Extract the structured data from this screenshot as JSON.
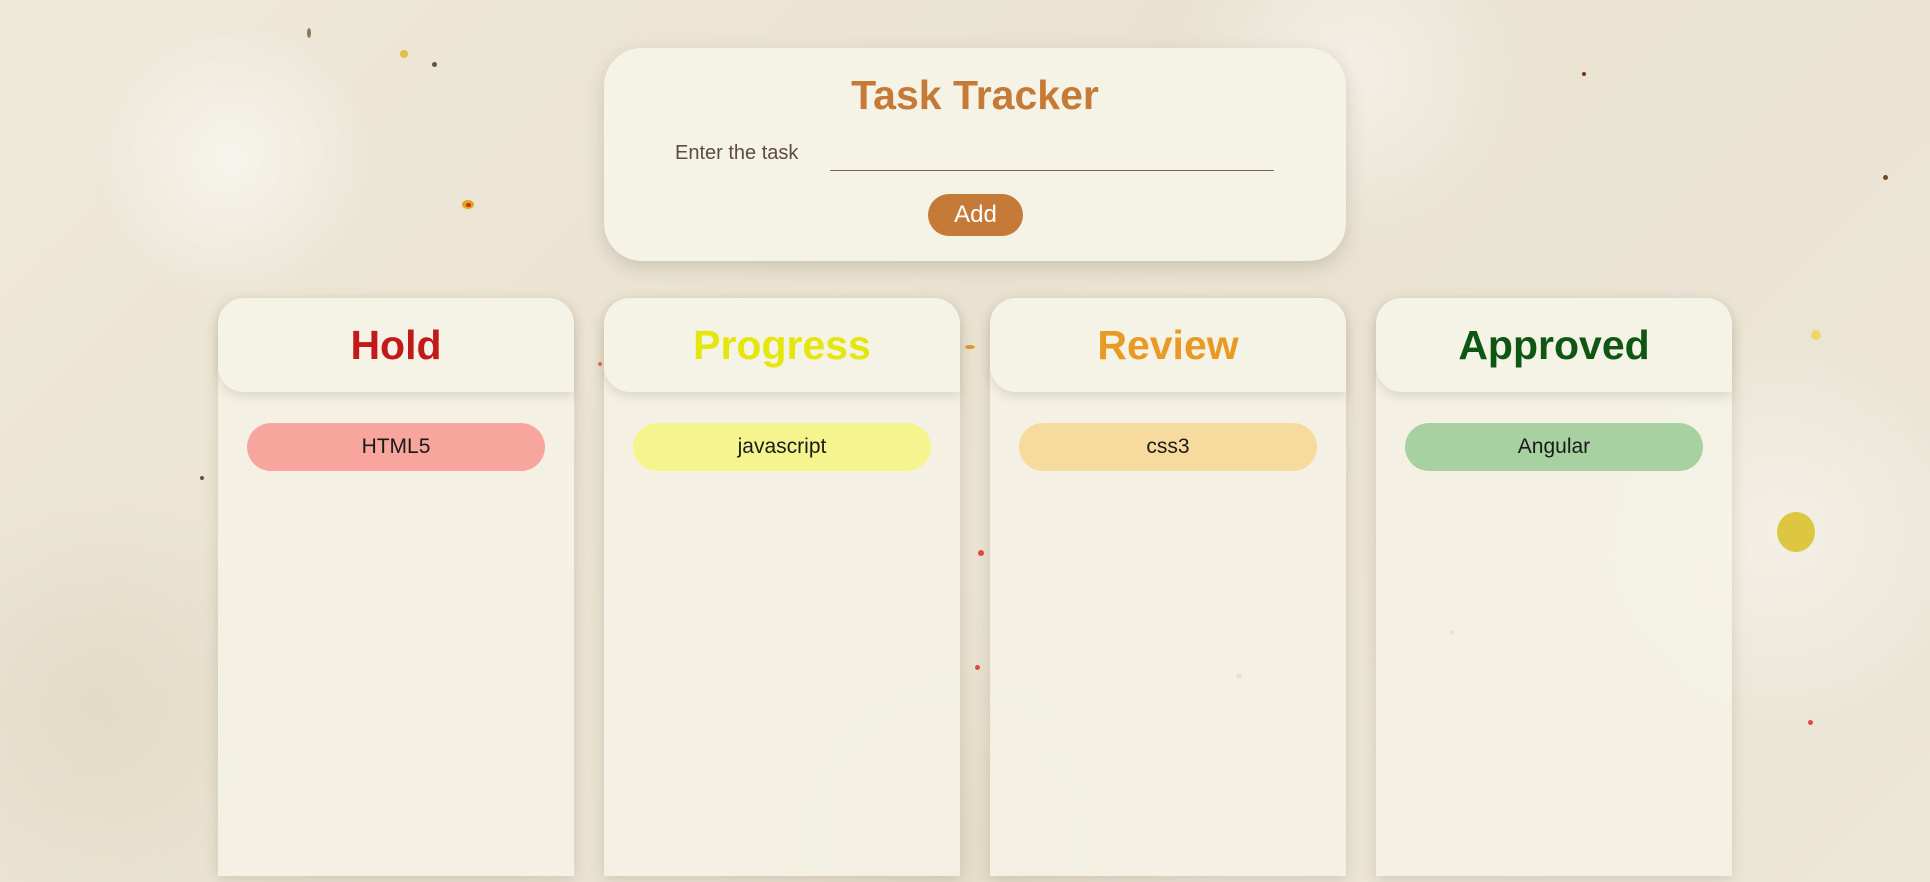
{
  "header": {
    "title": "Task Tracker",
    "input_label": "Enter the task",
    "input_value": "",
    "input_placeholder": "",
    "add_label": "Add"
  },
  "colors": {
    "accent": "#c67a38",
    "hold": "#c2191b",
    "progress": "#e6e60f",
    "review": "#e99a25",
    "approved": "#0f5614",
    "hold_pill": "#f8a59e",
    "progress_pill": "#f6f48f",
    "review_pill": "#f7da9e",
    "approved_pill": "#a7d1a1"
  },
  "columns": [
    {
      "title": "Hold",
      "tasks": [
        "HTML5"
      ]
    },
    {
      "title": "Progress",
      "tasks": [
        "javascript"
      ]
    },
    {
      "title": "Review",
      "tasks": [
        "css3"
      ]
    },
    {
      "title": "Approved",
      "tasks": [
        "Angular"
      ]
    }
  ]
}
